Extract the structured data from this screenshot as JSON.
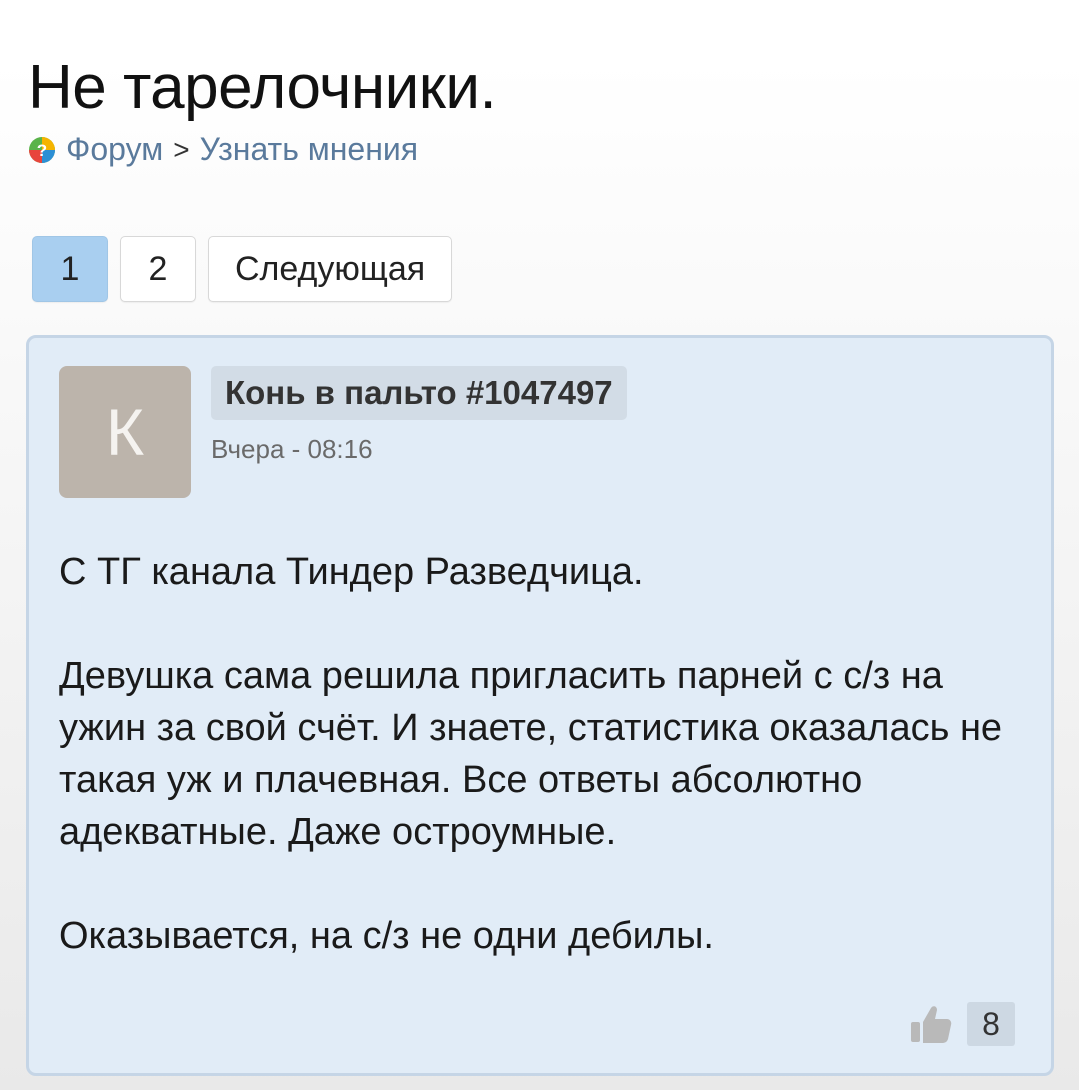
{
  "page": {
    "title": "Не тарелочники."
  },
  "breadcrumb": {
    "forum": "Форум",
    "separator": ">",
    "section": "Узнать мнения"
  },
  "pagination": {
    "pages": [
      "1",
      "2"
    ],
    "current": "1",
    "next_label": "Следующая"
  },
  "post": {
    "avatar_letter": "К",
    "author": "Конь в пальто #1047497",
    "time": "Вчера - 08:16",
    "paragraphs": [
      "С ТГ канала Тиндер Разведчица.",
      "Девушка сама решила пригласить парней с с/з на ужин за свой счёт. И знаете, статистика оказалась не такая уж и плачевная. Все ответы абсолютно адекватные. Даже остроумные.",
      "Оказывается, на с/з не одни дебилы."
    ],
    "likes": "8"
  },
  "icons": {
    "forum": "forum-question-icon",
    "like": "thumbs-up-icon"
  },
  "colors": {
    "active_page": "#a9cff0",
    "post_background": "#e1ecf7",
    "avatar": "#bcb4ab",
    "link": "#5a7a9c"
  }
}
